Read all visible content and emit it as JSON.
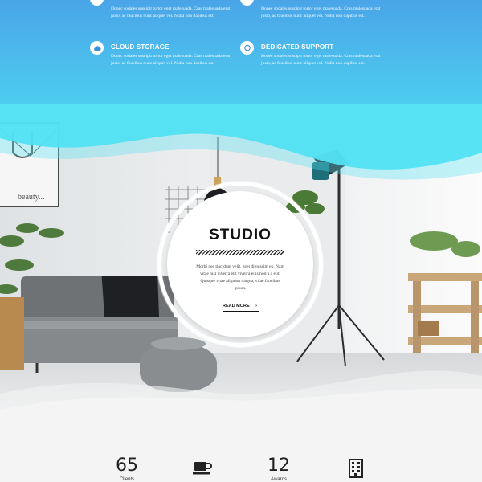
{
  "features": [
    {
      "title": "CLOUD STORAGE",
      "icon": "cloud-icon",
      "description": "Donec sodales suscipit tortor eget malesuada. Cras malesuada erat justo, ac faucibus nunc aliquet vel. Nulla non dapibus est."
    },
    {
      "title": "DEDICATED SUPPORT",
      "icon": "chat-bubble-icon",
      "description": "Donec sodales suscipit tortor eget malesuada. Cras malesuada erat justo, ac faucibus nunc aliquet vel. Nulla non dapibus est."
    }
  ],
  "top_partial_texts": [
    "Donec sodales suscipit tortor eget malesuada. Cras malesuada erat justo, ac faucibus nunc aliquet vel. Nulla non dapibus est.",
    "Donec sodales suscipit tortor eget malesuada. Cras malesuada erat justo, ac faucibus nunc aliquet vel. Nulla non dapibus est."
  ],
  "hero": {
    "frame_text": "beauty...",
    "title": "STUDIO",
    "description": "Morbi nec tincidunt velit, eget dignissim ex. Nam vitae nisl viverra elit viverra euismod a a elit. Quisque vitae aliquam magna, vitae faucibus ipsum.",
    "read_more": "READ MORE"
  },
  "stats": [
    {
      "number": "65",
      "label": "Clients",
      "icon": null
    },
    {
      "number": "",
      "label": "",
      "icon": "coffee-cup-icon"
    },
    {
      "number": "12",
      "label": "Awards",
      "icon": null
    },
    {
      "number": "",
      "label": "",
      "icon": "building-icon"
    }
  ],
  "colors": {
    "gradient_top": "#4aa5e8",
    "gradient_bottom": "#52e2f3",
    "text_dark": "#111111"
  }
}
